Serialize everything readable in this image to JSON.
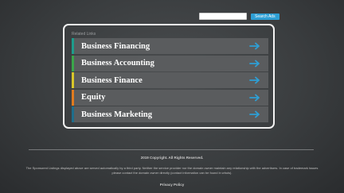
{
  "search": {
    "input_value": "",
    "button_label": "Search Ads"
  },
  "related": {
    "label": "Related Links",
    "items": [
      {
        "label": "Business Financing",
        "accent": "#1e9c8c",
        "icon": "arrow-right-icon"
      },
      {
        "label": "Business Accounting",
        "accent": "#3aa64a",
        "icon": "arrow-right-icon"
      },
      {
        "label": "Business Finance",
        "accent": "#d8c62a",
        "icon": "arrow-right-icon"
      },
      {
        "label": "Equity",
        "accent": "#e07b1f",
        "icon": "arrow-right-icon"
      },
      {
        "label": "Business Marketing",
        "accent": "#1f6e8c",
        "icon": "arrow-right-icon"
      }
    ]
  },
  "colors": {
    "arrow": "#2e9fd5",
    "search_button": "#2e9fd5"
  },
  "footer": {
    "copyright": "2019 Copyright. All Rights Reserved.",
    "disclaimer": "The Sponsored Listings displayed above are served automatically by a third party. Neither the service provider nor the domain owner maintain any relationship with the advertisers. In case of trademark issues please contact the domain owner directly (contact information can be found in whois).",
    "privacy": "Privacy Policy"
  }
}
